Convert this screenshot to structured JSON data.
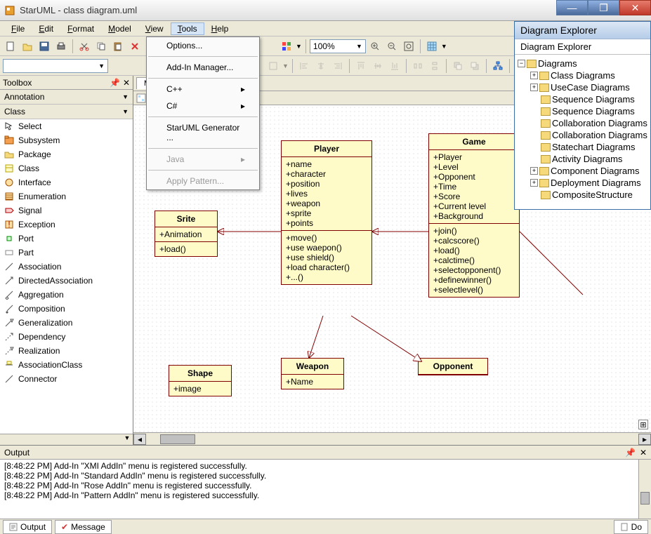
{
  "window": {
    "title": "StarUML - class diagram.uml"
  },
  "winbtns": {
    "min": "—",
    "max": "❐",
    "close": "✕"
  },
  "menus": [
    "File",
    "Edit",
    "Format",
    "Model",
    "View",
    "Tools",
    "Help"
  ],
  "active_menu_index": 5,
  "tools_menu": {
    "items": [
      {
        "label": "Options...",
        "sep_after": true
      },
      {
        "label": "Add-In Manager...",
        "sep_after": true
      },
      {
        "label": "C++",
        "submenu": true
      },
      {
        "label": "C#",
        "submenu": true,
        "sep_after": true
      },
      {
        "label": "StarUML Generator ...",
        "sep_after": true
      },
      {
        "label": "Java",
        "submenu": true,
        "disabled": true,
        "sep_after": true
      },
      {
        "label": "Apply Pattern...",
        "disabled": true
      }
    ]
  },
  "zoom": "100%",
  "toolbox": {
    "title": "Toolbox",
    "sections": {
      "annotation": "Annotation",
      "class": "Class"
    },
    "items": [
      {
        "label": "Select",
        "icon": "cursor"
      },
      {
        "label": "Subsystem",
        "icon": "box-orange"
      },
      {
        "label": "Package",
        "icon": "folder-orange"
      },
      {
        "label": "Class",
        "icon": "box-yellow"
      },
      {
        "label": "Interface",
        "icon": "circle"
      },
      {
        "label": "Enumeration",
        "icon": "box-lines"
      },
      {
        "label": "Signal",
        "icon": "signal"
      },
      {
        "label": "Exception",
        "icon": "exception"
      },
      {
        "label": "Port",
        "icon": "port"
      },
      {
        "label": "Part",
        "icon": "part"
      },
      {
        "label": "Association",
        "icon": "line"
      },
      {
        "label": "DirectedAssociation",
        "icon": "arrow"
      },
      {
        "label": "Aggregation",
        "icon": "diamond"
      },
      {
        "label": "Composition",
        "icon": "diamond-filled"
      },
      {
        "label": "Generalization",
        "icon": "tri"
      },
      {
        "label": "Dependency",
        "icon": "dashed"
      },
      {
        "label": "Realization",
        "icon": "dashed-tri"
      },
      {
        "label": "AssociationClass",
        "icon": "assoc-class"
      },
      {
        "label": "Connector",
        "icon": "connector"
      }
    ]
  },
  "canvas_tab": "Main",
  "uml": {
    "player": {
      "name": "Player",
      "attrs": [
        "+name",
        "+character",
        "+position",
        "+lives",
        "+weapon",
        "+sprite",
        "+points"
      ],
      "ops": [
        "+move()",
        "+use waepon()",
        "+use shield()",
        "+load character()",
        "+...()"
      ]
    },
    "game": {
      "name": "Game",
      "attrs": [
        "+Player",
        "+Level",
        "+Opponent",
        "+Time",
        "+Score",
        "+Current level",
        "+Background"
      ],
      "ops": [
        "+join()",
        "+calcscore()",
        "+load()",
        "+calctime()",
        "+selectopponent()",
        "+definewinner()",
        "+selectlevel()"
      ]
    },
    "srite": {
      "name": "Srite",
      "attrs": [
        "+Animation"
      ],
      "ops": [
        "+load()"
      ]
    },
    "shape": {
      "name": "Shape",
      "attrs": [
        "+image"
      ],
      "ops": []
    },
    "weapon": {
      "name": "Weapon",
      "attrs": [
        "+Name"
      ],
      "ops": []
    },
    "opponent": {
      "name": "Opponent",
      "attrs": [],
      "ops": []
    }
  },
  "explorer": {
    "title": "Diagram Explorer",
    "title2": "Diagram Explorer",
    "root": "Diagrams",
    "children": [
      {
        "label": "Class Diagrams",
        "exp": true
      },
      {
        "label": "UseCase Diagrams",
        "exp": true
      },
      {
        "label": "Sequence Diagrams"
      },
      {
        "label": "Sequence Diagrams"
      },
      {
        "label": "Collaboration Diagrams"
      },
      {
        "label": "Collaboration Diagrams"
      },
      {
        "label": "Statechart Diagrams"
      },
      {
        "label": "Activity Diagrams"
      },
      {
        "label": "Component Diagrams",
        "exp": true
      },
      {
        "label": "Deployment Diagrams",
        "exp": true
      },
      {
        "label": "CompositeStructure"
      }
    ]
  },
  "output": {
    "title": "Output",
    "lines": [
      "[8:48:22 PM]  Add-In \"Pattern AddIn\" menu is registered successfully.",
      "[8:48:22 PM]  Add-In \"Rose AddIn\" menu is registered successfully.",
      "[8:48:22 PM]  Add-In \"Standard AddIn\" menu is registered successfully.",
      "[8:48:22 PM]  Add-In \"XMI AddIn\" menu is registered successfully."
    ]
  },
  "bottom_tabs": {
    "output": "Output",
    "message": "Message",
    "doc": "Do"
  }
}
